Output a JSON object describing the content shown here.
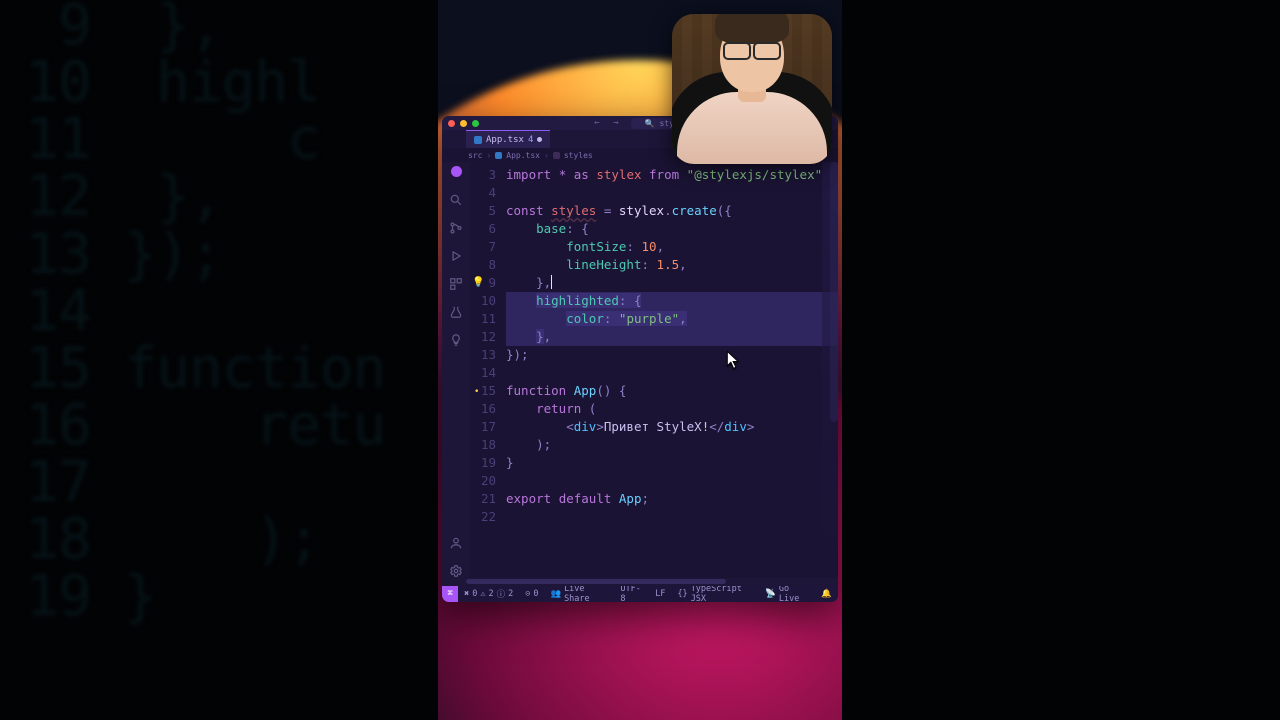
{
  "titlebar": {
    "search_placeholder": "styles dev"
  },
  "tab": {
    "filename": "App.tsx",
    "problems": "4"
  },
  "breadcrumbs": {
    "a": "src",
    "b": "App.tsx",
    "c": "styles"
  },
  "activity_icons": [
    "files",
    "search",
    "git",
    "debug",
    "extensions",
    "test",
    "lightbulb"
  ],
  "gutter": {
    "l3": "3",
    "l4": "4",
    "l5": "5",
    "l6": "6",
    "l7": "7",
    "l8": "8",
    "l9": "9",
    "l10": "10",
    "l11": "11",
    "l12": "12",
    "l13": "13",
    "l14": "14",
    "l15": "15",
    "l16": "16",
    "l17": "17",
    "l18": "18",
    "l19": "19",
    "l20": "20",
    "l21": "21",
    "l22": "22"
  },
  "code": {
    "l3": {
      "kw_import": "import",
      "star": "*",
      "kw_as": "as",
      "alias": "stylex",
      "kw_from": "from",
      "pkg": "\"@stylexjs/stylex\""
    },
    "l5": {
      "kw_const": "const",
      "name": "styles",
      "eq": " = ",
      "ns": "stylex",
      "dot": ".",
      "fn": "create",
      "open": "({"
    },
    "l6": {
      "key": "base",
      "open": ": {"
    },
    "l7": {
      "key": "fontSize",
      "colon": ": ",
      "val": "10",
      "comma": ","
    },
    "l8": {
      "key": "lineHeight",
      "colon": ": ",
      "val": "1.5",
      "comma": ","
    },
    "l9": {
      "close": "}",
      "comma": ","
    },
    "l10": {
      "key": "highlighted",
      "open": ": {"
    },
    "l11": {
      "key": "color",
      "colon": ": ",
      "val": "\"purple\"",
      "comma": ","
    },
    "l12": {
      "close": "}",
      "comma": ","
    },
    "l13": {
      "close": "});"
    },
    "l15": {
      "kw_fn": "function",
      "name": "App",
      "parens": "() {"
    },
    "l16": {
      "kw_ret": "return",
      "open": " ("
    },
    "l17": {
      "open": "<",
      "tag": "div",
      "gt": ">",
      "text": "Привет StyleX!",
      "lts": "</",
      "tag2": "div",
      "gt2": ">"
    },
    "l18": {
      "close": ");"
    },
    "l19": {
      "close": "}"
    },
    "l21": {
      "kw_export": "export",
      "kw_default": "default",
      "name": "App",
      "semi": ";"
    }
  },
  "status": {
    "remote_icon": "⎇",
    "errors": "0",
    "warns": "2",
    "hints": "2",
    "ports_icon": "⊝",
    "ports": "0",
    "liveshare": "Live Share",
    "encoding": "UTF-8",
    "eol": "LF",
    "lang": "TypeScript JSX",
    "golive": "Go Live",
    "bell": "🔔"
  },
  "bg_lines": {
    "a": "   9  },",
    "b": "  10  highl",
    "c": "  11      c",
    "d": "  12  },",
    "e": "  13 });",
    "f": "  14",
    "g": "  15 function",
    "h": "  16     retu",
    "i": "  17        ",
    "j": "  18     );",
    "k": "  19 }"
  }
}
